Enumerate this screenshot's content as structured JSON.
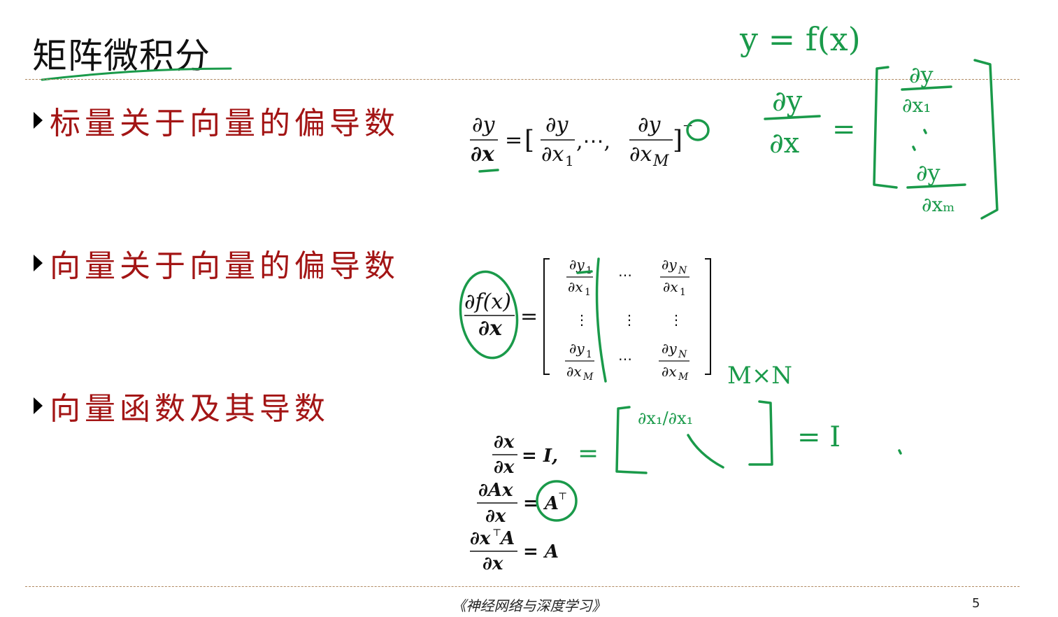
{
  "slide": {
    "title": "矩阵微积分",
    "bullets": [
      "标量关于向量的偏导数",
      "向量关于向量的偏导数",
      "向量函数及其导数"
    ],
    "footer": "《神经网络与深度学习》",
    "page_number": "5"
  },
  "formulas": {
    "scalar_vector": {
      "lhs_num": "∂y",
      "lhs_den": "∂x",
      "eq": "=",
      "open": "[",
      "t1_num": "∂y",
      "t1_den": "∂x",
      "t1_sub": "1",
      "sep": ",⋯,",
      "t2_num": "∂y",
      "t2_den": "∂x",
      "t2_sub": "M",
      "close": "]",
      "transpose": "⊤"
    },
    "vector_vector": {
      "lhs_num": "∂f(x)",
      "lhs_den": "∂x",
      "eq": "=",
      "c11_num": "∂y",
      "c11_num_sub": "1",
      "c11_den": "∂x",
      "c11_den_sub": "1",
      "c13_num": "∂y",
      "c13_num_sub": "N",
      "c13_den": "∂x",
      "c13_den_sub": "1",
      "c31_num": "∂y",
      "c31_num_sub": "1",
      "c31_den": "∂x",
      "c31_den_sub": "M",
      "c33_num": "∂y",
      "c33_num_sub": "N",
      "c33_den": "∂x",
      "c33_den_sub": "M",
      "hdots": "⋯",
      "vdots": "⋮"
    },
    "identities": [
      {
        "num": "∂x",
        "den": "∂x",
        "rhs": "= I,"
      },
      {
        "num": "∂Ax",
        "den": "∂x",
        "rhs": "= A",
        "sup": "⊤"
      },
      {
        "num": "∂x",
        "num_sup": "⊤",
        "num_tail": "A",
        "den": "∂x",
        "rhs": "= A"
      }
    ]
  },
  "annotations": {
    "color": "#1a9a4a",
    "function_def": "y = f(x)",
    "column_vector_lhs_num": "∂y",
    "column_vector_lhs_den": "∂x",
    "column_top_num": "∂y",
    "column_top_den": "∂x₁",
    "column_bottom_num": "∂y",
    "column_bottom_den": "∂xₘ",
    "size_note": "M×N",
    "identity_matrix_top_left": "∂x₁/∂x₁",
    "identity_result": "= I",
    "equals_sign": "="
  }
}
